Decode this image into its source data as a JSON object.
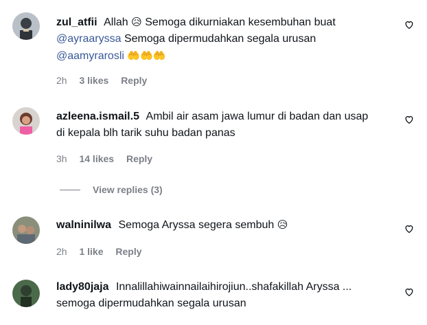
{
  "comments": [
    {
      "username": "zul_atfii",
      "line1": "Allah",
      "line1_emoji": "😥",
      "line1_rest": "Semoga dikurniakan kesembuhan buat",
      "line2_mention": "@ayraaryssa",
      "line2_rest": "Semoga dipermudahkan segala urusan",
      "line3_mention": "@aamyrarosli",
      "line3_emoji": "🤲🤲🤲",
      "time": "2h",
      "likes": "3 likes",
      "reply": "Reply"
    },
    {
      "username": "azleena.ismail.5",
      "line1": "Ambil air asam jawa lumur di badan dan usap",
      "line2": "di kepala blh tarik suhu badan panas",
      "time": "3h",
      "likes": "14 likes",
      "reply": "Reply",
      "view_replies": "View replies (3)"
    },
    {
      "username": "walninilwa",
      "line1": "Semoga Aryssa segera sembuh",
      "line1_emoji": "😥",
      "time": "2h",
      "likes": "1 like",
      "reply": "Reply"
    },
    {
      "username": "lady80jaja",
      "line1": "Innalillahiwainnailaihirojiun..shafakillah Aryssa ...",
      "line2": "semoga dipermudahkan segala urusan"
    }
  ],
  "icons": {
    "like": "heart-outline-icon",
    "avatar": "avatar"
  }
}
